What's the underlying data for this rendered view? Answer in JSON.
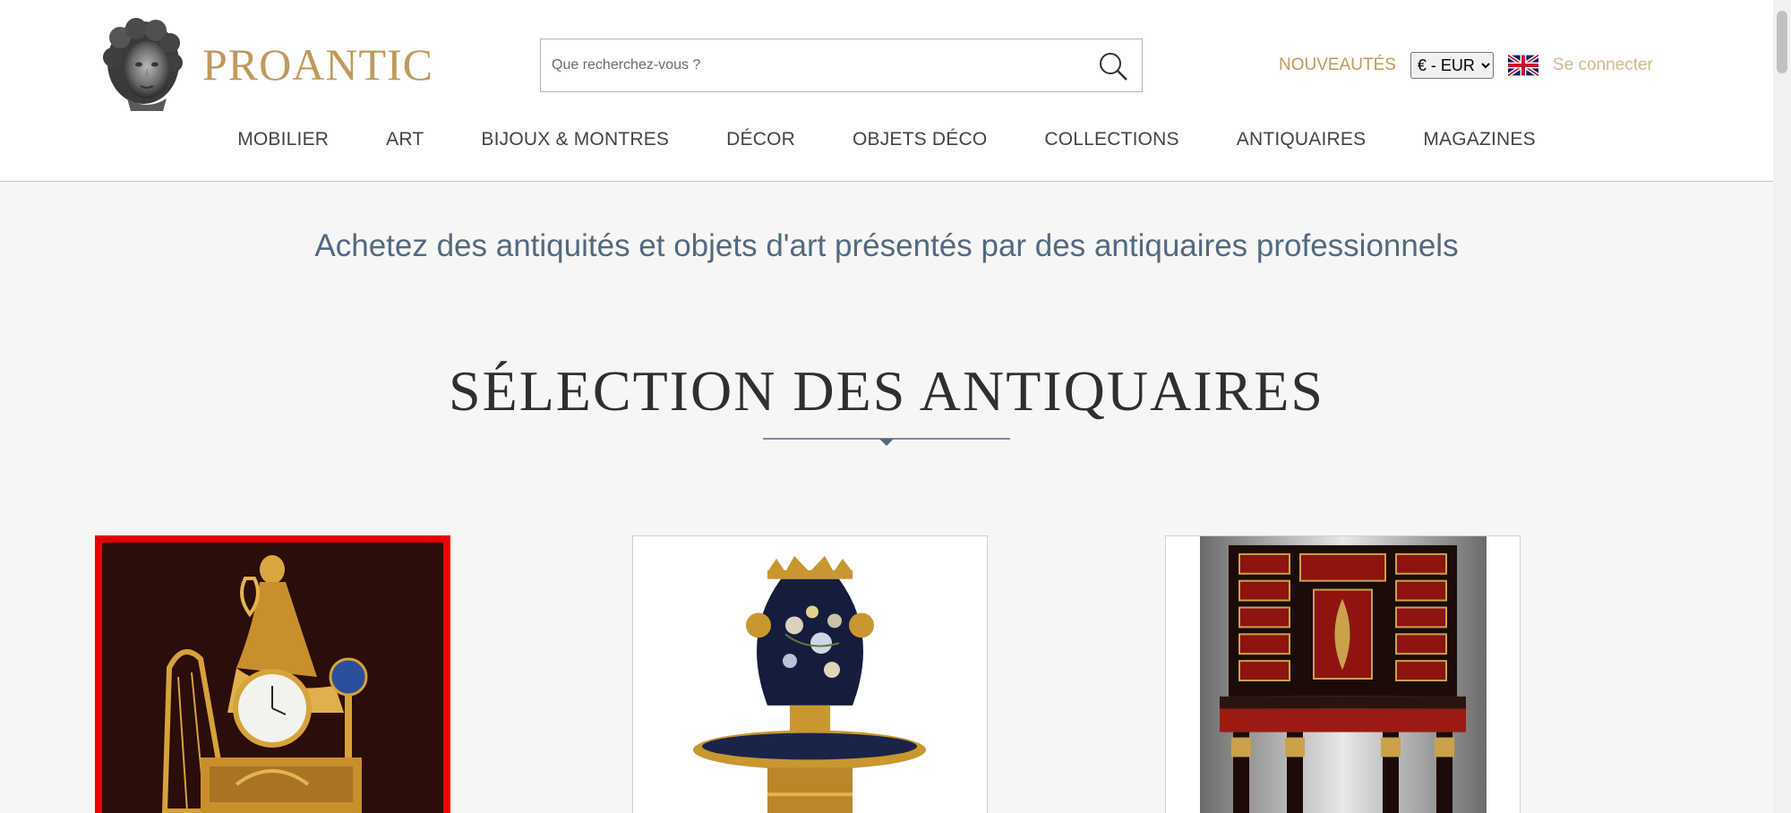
{
  "header": {
    "logo_text": "PROANTIC",
    "search_placeholder": "Que recherchez-vous ?",
    "new_label": "NOUVEAUTÉS",
    "currency_selected": "€ - EUR",
    "login_label": "Se connecter",
    "colors": {
      "gold": "#c09a5b",
      "nav_text": "#444444",
      "tagline": "#526982"
    }
  },
  "nav": {
    "items": [
      {
        "label": "MOBILIER"
      },
      {
        "label": "ART"
      },
      {
        "label": "BIJOUX & MONTRES"
      },
      {
        "label": "DÉCOR"
      },
      {
        "label": "OBJETS DÉCO"
      },
      {
        "label": "COLLECTIONS"
      },
      {
        "label": "ANTIQUAIRES"
      },
      {
        "label": "MAGAZINES"
      }
    ]
  },
  "main": {
    "tagline": "Achetez des antiquités et objets d'art présentés par des antiquaires professionnels",
    "section_title": "SÉLECTION DES ANTIQUAIRES",
    "cards": [
      {
        "image": "gilt-bronze-lyre-clock",
        "selected": true
      },
      {
        "image": "porcelain-gilt-vase-stand",
        "selected": false
      },
      {
        "image": "tortoiseshell-cabinet",
        "selected": false
      }
    ]
  },
  "icons": {
    "search": "search-icon",
    "flag": "uk-flag-icon",
    "logo": "sculpted-head-logo"
  }
}
